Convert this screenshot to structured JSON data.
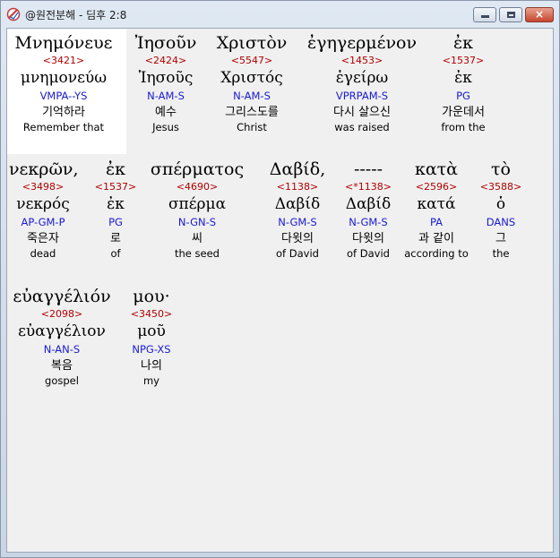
{
  "window": {
    "title": "@원전분해 - 딤후 2:8",
    "controls": {
      "minimize": "minimize-button",
      "maximize": "maximize-button",
      "close": "×"
    }
  },
  "words": [
    {
      "greek": "Μνημόνευε",
      "strong": "<3421>",
      "lemma": "μνημονεύω",
      "parse": "VMPA--YS",
      "korean": "기억하라",
      "english": "Remember that"
    },
    {
      "greek": "Ἰησοῦν",
      "strong": "<2424>",
      "lemma": "Ἰησοῦς",
      "parse": "N-AM-S",
      "korean": "예수",
      "english": "Jesus"
    },
    {
      "greek": "Χριστὸν",
      "strong": "<5547>",
      "lemma": "Χριστός",
      "parse": "N-AM-S",
      "korean": "그리스도를",
      "english": "Christ"
    },
    {
      "greek": "ἐγηγερμένον",
      "strong": "<1453>",
      "lemma": "ἐγείρω",
      "parse": "VPRPAM-S",
      "korean": "다시 살으신",
      "english": "was raised"
    },
    {
      "greek": "ἐκ",
      "strong": "<1537>",
      "lemma": "ἐκ",
      "parse": "PG",
      "korean": "가운데서",
      "english": "from the"
    },
    {
      "greek": "νεκρῶν,",
      "strong": "<3498>",
      "lemma": "νεκρός",
      "parse": "AP-GM-P",
      "korean": "죽은자",
      "english": "dead"
    },
    {
      "greek": "ἐκ",
      "strong": "<1537>",
      "lemma": "ἐκ",
      "parse": "PG",
      "korean": "로",
      "english": "of"
    },
    {
      "greek": "σπέρματος",
      "strong": "<4690>",
      "lemma": "σπέρμα",
      "parse": "N-GN-S",
      "korean": "씨",
      "english": "the seed"
    },
    {
      "greek": "Δαβίδ,",
      "strong": "<1138>",
      "lemma": "Δαβίδ",
      "parse": "N-GM-S",
      "korean": "다윗의",
      "english": "of David"
    },
    {
      "greek": "-----",
      "strong": "<*1138>",
      "lemma": "Δαβίδ",
      "parse": "N-GM-S",
      "korean": "다윗의",
      "english": "of David"
    },
    {
      "greek": "κατὰ",
      "strong": "<2596>",
      "lemma": "κατά",
      "parse": "PA",
      "korean": "과 같이",
      "english": "according to"
    },
    {
      "greek": "τὸ",
      "strong": "<3588>",
      "lemma": "ὁ",
      "parse": "DANS",
      "korean": "그",
      "english": "the"
    },
    {
      "greek": "εὐαγγέλιόν",
      "strong": "<2098>",
      "lemma": "εὐαγγέλιον",
      "parse": "N-AN-S",
      "korean": "복음",
      "english": "gospel"
    },
    {
      "greek": "μου·",
      "strong": "<3450>",
      "lemma": "μοῦ",
      "parse": "NPG-XS",
      "korean": "나의",
      "english": "my"
    }
  ]
}
